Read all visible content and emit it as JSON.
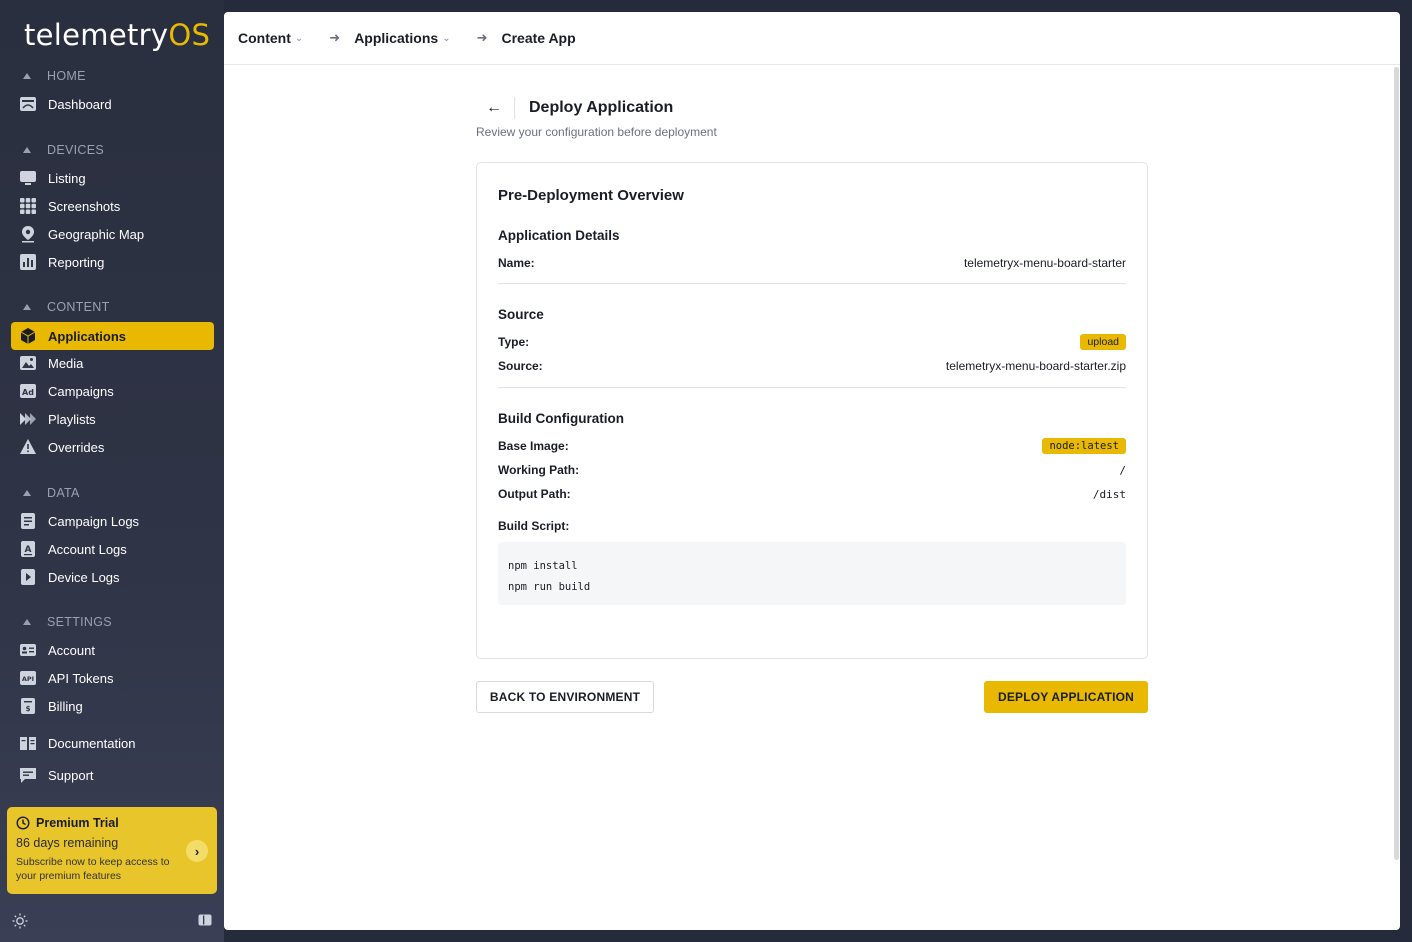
{
  "brand": {
    "name_main": "telemetry",
    "name_accent": "OS",
    "accent_color": "#e8b900"
  },
  "sidebar": {
    "sections": [
      {
        "title": "HOME",
        "items": [
          {
            "label": "Dashboard",
            "icon": "dashboard-icon"
          }
        ]
      },
      {
        "title": "DEVICES",
        "items": [
          {
            "label": "Listing",
            "icon": "monitor-icon"
          },
          {
            "label": "Screenshots",
            "icon": "grid-icon"
          },
          {
            "label": "Geographic Map",
            "icon": "map-pin-icon"
          },
          {
            "label": "Reporting",
            "icon": "bar-chart-icon"
          }
        ]
      },
      {
        "title": "CONTENT",
        "items": [
          {
            "label": "Applications",
            "icon": "cube-icon",
            "active": true
          },
          {
            "label": "Media",
            "icon": "image-icon"
          },
          {
            "label": "Campaigns",
            "icon": "ad-icon"
          },
          {
            "label": "Playlists",
            "icon": "playlist-icon"
          },
          {
            "label": "Overrides",
            "icon": "warning-icon"
          }
        ]
      },
      {
        "title": "DATA",
        "items": [
          {
            "label": "Campaign Logs",
            "icon": "document-icon"
          },
          {
            "label": "Account Logs",
            "icon": "account-log-icon"
          },
          {
            "label": "Device Logs",
            "icon": "play-log-icon"
          }
        ]
      },
      {
        "title": "SETTINGS",
        "items": [
          {
            "label": "Account",
            "icon": "id-card-icon"
          },
          {
            "label": "API Tokens",
            "icon": "api-icon"
          },
          {
            "label": "Billing",
            "icon": "billing-icon"
          }
        ]
      }
    ],
    "extra_items": [
      {
        "label": "Documentation",
        "icon": "book-icon"
      },
      {
        "label": "Support",
        "icon": "chat-icon"
      }
    ],
    "trial": {
      "title": "Premium Trial",
      "days": "86 days remaining",
      "subtitle": "Subscribe now to keep access to your premium features"
    }
  },
  "breadcrumb": {
    "items": [
      "Content",
      "Applications",
      "Create App"
    ]
  },
  "page": {
    "back_glyph": "←",
    "title": "Deploy Application",
    "subtitle": "Review your configuration before deployment"
  },
  "overview": {
    "title": "Pre-Deployment Overview",
    "app_details": {
      "title": "Application Details",
      "name_label": "Name:",
      "name_value": "telemetryx-menu-board-starter"
    },
    "source": {
      "title": "Source",
      "type_label": "Type:",
      "type_value": "upload",
      "source_label": "Source:",
      "source_value": "telemetryx-menu-board-starter.zip"
    },
    "build": {
      "title": "Build Configuration",
      "base_image_label": "Base Image:",
      "base_image_value": "node:latest",
      "working_path_label": "Working Path:",
      "working_path_value": "/",
      "output_path_label": "Output Path:",
      "output_path_value": "/dist",
      "script_label": "Build Script:",
      "script_lines": [
        "npm install",
        "npm run build"
      ]
    }
  },
  "actions": {
    "back_label": "BACK TO ENVIRONMENT",
    "deploy_label": "DEPLOY APPLICATION"
  }
}
